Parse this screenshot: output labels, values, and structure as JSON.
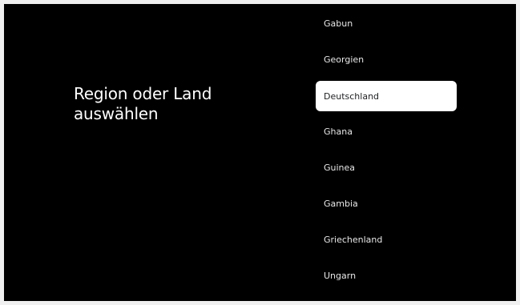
{
  "heading": {
    "title": "Region oder Land auswählen"
  },
  "country_list": {
    "selected_index": 2,
    "items": [
      {
        "label": "Gabun"
      },
      {
        "label": "Georgien"
      },
      {
        "label": "Deutschland"
      },
      {
        "label": "Ghana"
      },
      {
        "label": "Guinea"
      },
      {
        "label": "Gambia"
      },
      {
        "label": "Griechenland"
      },
      {
        "label": "Ungarn"
      }
    ]
  },
  "colors": {
    "background": "#000000",
    "text": "#ffffff",
    "selected_background": "#ffffff",
    "selected_text": "#202124"
  }
}
